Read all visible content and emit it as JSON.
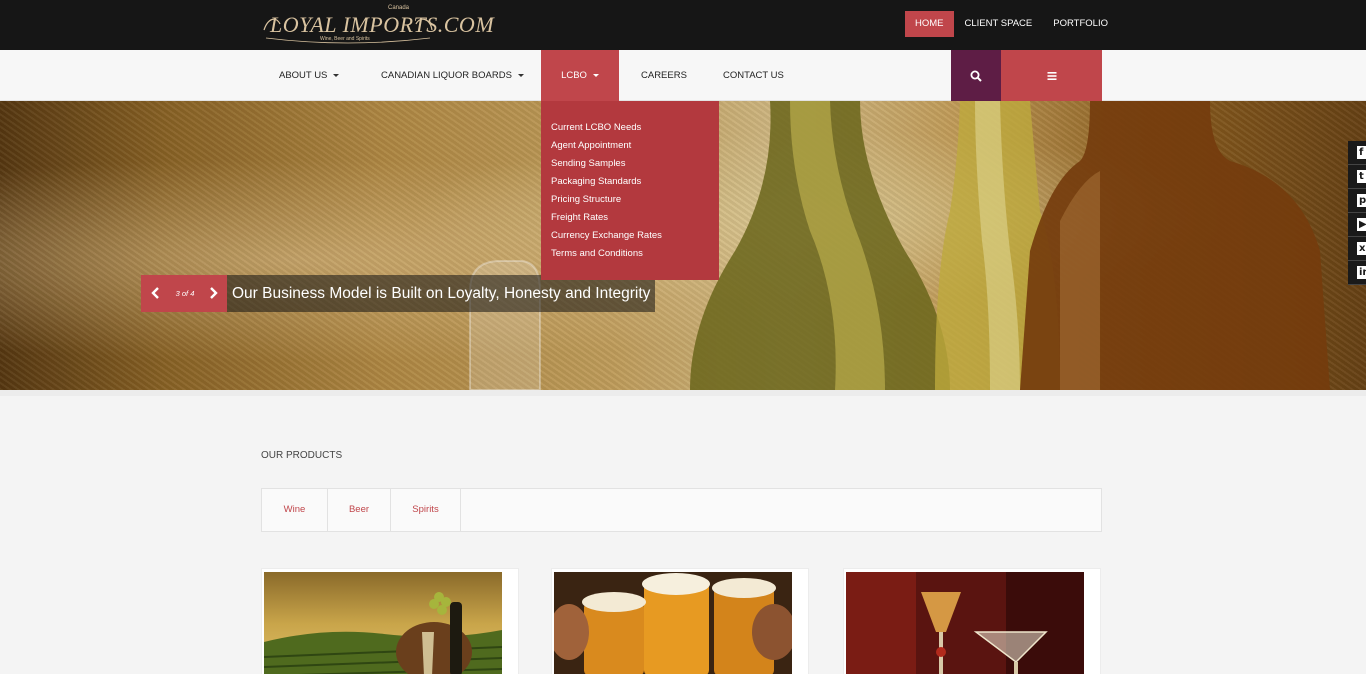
{
  "header": {
    "logo_name": "LOYAL IMPORTS.COM",
    "logo_country": "Canada",
    "logo_tagline": "Wine, Beer and Spirits",
    "top_links": [
      {
        "label": "HOME",
        "active": true
      },
      {
        "label": "CLIENT SPACE",
        "active": false
      },
      {
        "label": "PORTFOLIO",
        "active": false
      }
    ]
  },
  "nav": {
    "items": [
      {
        "label": "ABOUT US",
        "dropdown": true
      },
      {
        "label": "CANADIAN LIQUOR BOARDS",
        "dropdown": true
      },
      {
        "label": "LCBO",
        "dropdown": true,
        "active": true
      },
      {
        "label": "CAREERS",
        "dropdown": false
      },
      {
        "label": "CONTACT US",
        "dropdown": false
      }
    ],
    "search_icon": "search-icon",
    "menu_icon": "hamburger-menu-icon"
  },
  "dropdown": {
    "items": [
      "Current LCBO Needs",
      "Agent Appointment",
      "Sending Samples",
      "Packaging Standards",
      "Pricing Structure",
      "Freight Rates",
      "Currency Exchange Rates",
      "Terms and Conditions"
    ]
  },
  "slider": {
    "counter": "3 of 4",
    "caption": "Our Business Model is Built on Loyalty, Honesty and Integrity"
  },
  "social": [
    "facebook-icon",
    "twitter-icon",
    "pinterest-icon",
    "youtube-icon",
    "xing-icon",
    "linkedin-icon"
  ],
  "products": {
    "heading": "OUR PRODUCTS",
    "tabs": [
      "Wine",
      "Beer",
      "Spirits"
    ],
    "cards": [
      {
        "subject": "vineyard-wine-image"
      },
      {
        "subject": "beer-toast-image"
      },
      {
        "subject": "spirits-glasses-image"
      }
    ]
  },
  "colors": {
    "accent": "#c0464b",
    "search_bg": "#5e1d45",
    "topbar": "#161616"
  }
}
